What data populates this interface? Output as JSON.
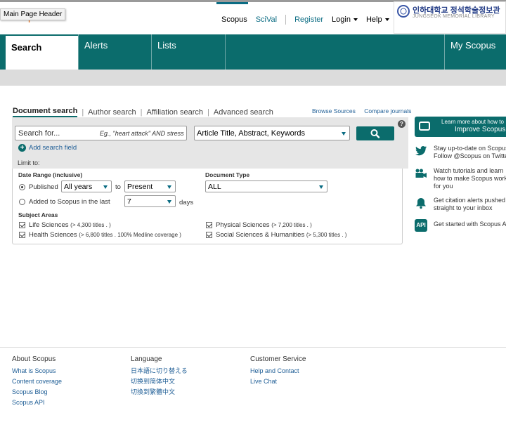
{
  "tooltip": "Main Page Header",
  "brand": "Scopus",
  "topnav": {
    "scopus": "Scopus",
    "scival": "SciVal",
    "register": "Register",
    "login": "Login",
    "help": "Help"
  },
  "library": {
    "name": "인하대학교 정석학술정보관",
    "sub": "JUNGSEOK MEMORIAL LIBRARY"
  },
  "tabs": {
    "search": "Search",
    "alerts": "Alerts",
    "lists": "Lists",
    "my_scopus": "My Scopus"
  },
  "search_tabs": {
    "document": "Document search",
    "author": "Author search",
    "affiliation": "Affiliation search",
    "advanced": "Advanced search",
    "browse_sources": "Browse Sources",
    "compare_journals": "Compare journals"
  },
  "search": {
    "placeholder": "Search for...",
    "example": "Eg., \"heart attack\" AND stress",
    "field": "Article Title, Abstract, Keywords",
    "help": "?",
    "add_field": "Add search field",
    "limit_to": "Limit to:"
  },
  "limits": {
    "date_range_label": "Date Range (inclusive)",
    "published": "Published",
    "from_value": "All years",
    "to": "to",
    "to_value": "Present",
    "added_label": "Added to Scopus in the last",
    "added_value": "7",
    "days": "days",
    "doc_type_label": "Document Type",
    "doc_type_value": "ALL",
    "subject_areas_label": "Subject Areas",
    "areas": [
      {
        "name": "Life Sciences",
        "count": "(> 4,300 titles . )"
      },
      {
        "name": "Health Sciences",
        "count": "(> 6,800 titles . 100% Medline coverage )"
      },
      {
        "name": "Physical Sciences",
        "count": "(> 7,200 titles . )"
      },
      {
        "name": "Social Sciences & Humanities",
        "count": "(> 5,300 titles . )"
      }
    ]
  },
  "sidebar": {
    "learn_line1": "Learn more about how to",
    "learn_line2": "Improve Scopus",
    "twitter_1": "Stay up-to-date on Scopus",
    "twitter_2": "Follow @Scopus on Twitter",
    "video_1": "Watch tutorials and learn",
    "video_2": "how to make Scopus work",
    "video_3": "for you",
    "alert_1": "Get citation alerts pushed",
    "alert_2": "straight to your inbox",
    "api_icon": "API",
    "api_1": "Get started with Scopus API"
  },
  "footer": {
    "about": {
      "heading": "About Scopus",
      "links": [
        "What is Scopus",
        "Content coverage",
        "Scopus Blog",
        "Scopus API"
      ]
    },
    "language": {
      "heading": "Language",
      "links": [
        "日本語に切り替える",
        "切换到简体中文",
        "切換到繁體中文"
      ]
    },
    "service": {
      "heading": "Customer Service",
      "links": [
        "Help and Contact",
        "Live Chat"
      ]
    }
  },
  "colors": {
    "teal": "#0b6c6c",
    "link": "#1f5e96",
    "brand_orange": "#e9711c"
  }
}
